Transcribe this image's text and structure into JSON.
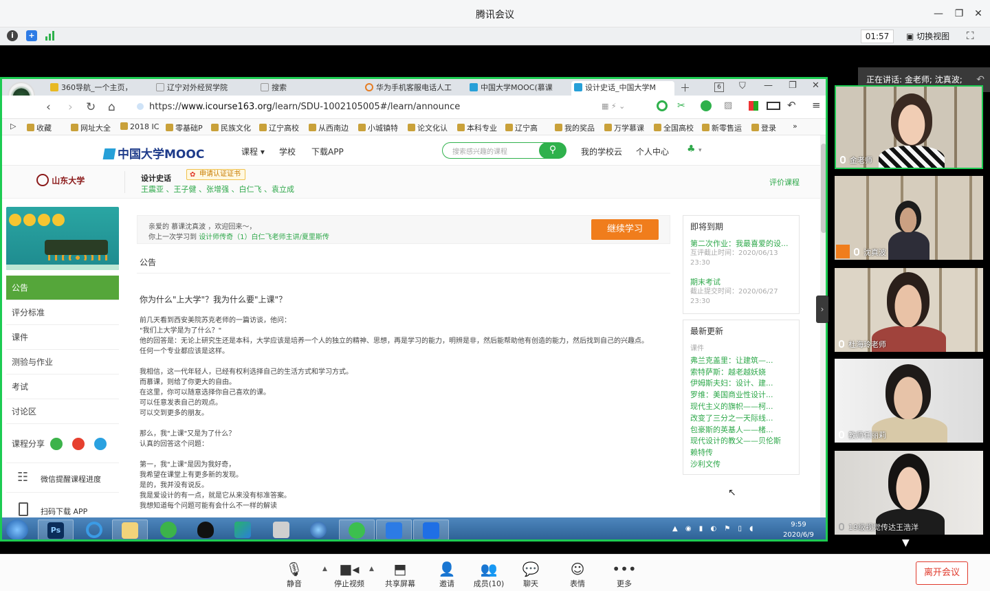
{
  "app": {
    "title": "腾讯会议"
  },
  "toolbar": {
    "timer": "01:57",
    "switch_view": "切换视图"
  },
  "browser": {
    "tabs": [
      "360导航_一个主页，",
      "辽宁对外经贸学院",
      "搜索",
      "华为手机客服电话人工",
      "中国大学MOOC(慕课",
      "设计史话_中国大学M"
    ],
    "url_prefix": "https://",
    "url_domain": "www.icourse163.org",
    "url_path": "/learn/SDU-1002105005#/learn/announce",
    "bookmarks": [
      "收藏",
      "网址大全",
      "2018 IC",
      "零基础P",
      "民族文化",
      "辽宁高校",
      "从西南边",
      "小城镇特",
      "论文化认",
      "本科专业",
      "辽宁高",
      "我的奖品",
      "万学慕课",
      "全国高校",
      "新零售运",
      "登录"
    ]
  },
  "site": {
    "logo": "中国大学MOOC",
    "nav": [
      "课程",
      "学校",
      "下载APP"
    ],
    "search_placeholder": "搜索感兴趣的课程",
    "nav_right": [
      "我的学校云",
      "个人中心"
    ]
  },
  "course": {
    "school": "山东大学",
    "name": "设计史话",
    "cert": "申请认证证书",
    "teachers": "王震亚 、王子健 、张增强 、白仁飞 、袁立成",
    "rate": "评价课程"
  },
  "sidebar": {
    "items": [
      "公告",
      "评分标准",
      "课件",
      "测验与作业",
      "考试",
      "讨论区"
    ],
    "share": "课程分享",
    "wechat_reminder": "微信提醒课程进度",
    "scan_download": "扫码下载 APP"
  },
  "welcome": {
    "line1": "亲爱的 慕课沈真波 ，欢迎回来～，",
    "line2_prefix": "你上一次学习到",
    "line2_link": "设计师传奇（1）白仁飞老师主讲/夏里斯传",
    "continue": "继续学习"
  },
  "announcement": {
    "heading": "公告",
    "title": "你为什么\"上大学\"？我为什么要\"上课\"？",
    "paragraphs": [
      [
        "前几天看到西安美院苏克老师的一篇访谈，他问：",
        "\"我们上大学是为了什么？\"",
        "他的回答是：无论上研究生还是本科，大学应该是培养一个人的独立的精神、思想，再是学习的能力，明辨是非，然后能帮助他有创造的能力，然后找到自己的兴趣点。",
        "任何一个专业都应该是这样。"
      ],
      [
        "我相信，这一代年轻人，已经有权利选择自己的生活方式和学习方式。",
        "而慕课，则给了你更大的自由。",
        "在这里，你可以随意选择你自己喜欢的课。",
        "可以任意发表自己的观点。",
        "可以交到更多的朋友。"
      ],
      [
        "那么，我\"上课\"又是为了什么？",
        "认真的回答这个问题："
      ],
      [
        "第一，我\"上课\"是因为我好奇，",
        "我希望在课堂上有更多新的发现。",
        "是的，我并没有说反。",
        "我是爱设计的有一点，就是它从来没有标准答案。",
        "我想知道每个问题可能有会什么不一样的解读"
      ]
    ]
  },
  "upcoming": {
    "title": "即将到期",
    "items": [
      {
        "name": "第二次作业：我最喜爱的设...",
        "label": "互评截止时间：2020/06/13",
        "time": "23:30"
      },
      {
        "name": "期末考试",
        "label": "截止提交时间：2020/06/27",
        "time": "23:30"
      }
    ]
  },
  "updates": {
    "title": "最新更新",
    "category": "课件",
    "items": [
      "弗兰克盖里：让建筑—...",
      "索特萨斯：越老越妖娆",
      "伊姆斯夫妇：设计、建...",
      "罗维：美国商业性设计...",
      "现代主义的旗帜——柯...",
      "改变了三分之一天际线...",
      "包豪斯的英基人——楮...",
      "现代设计的教父——贝伦斯",
      "赖特传",
      "沙利文传"
    ]
  },
  "taskbar": {
    "time": "9:59",
    "date": "2020/6/9"
  },
  "meeting": {
    "speaking": "正在讲话: 金老师; 沈真波;",
    "participants": [
      "金老师",
      "沈真波",
      "杜海玲老师",
      "教师任丽莉",
      "19级视觉传达王浩洋"
    ]
  },
  "controls": {
    "mute": "静音",
    "stop_video": "停止视频",
    "share_screen": "共享屏幕",
    "invite": "邀请",
    "members": "成员(10)",
    "chat": "聊天",
    "reactions": "表情",
    "more": "更多",
    "leave": "离开会议"
  },
  "colors": {
    "accent_green": "#1dcb52",
    "mooc_green": "#2ea84a",
    "leave_red": "#e0392b",
    "continue_orange": "#f07d1c"
  }
}
